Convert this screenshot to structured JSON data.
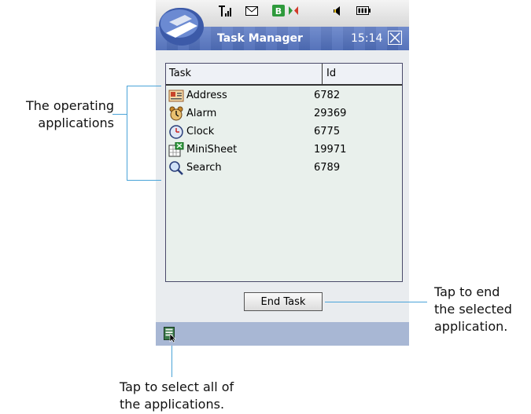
{
  "status_bar": {
    "icons": [
      "signal-icon",
      "message-icon",
      "bluetooth-icon",
      "sync-icon",
      "speaker-icon",
      "battery-icon"
    ]
  },
  "title_bar": {
    "title": "Task Manager",
    "time": "15:14"
  },
  "task_table": {
    "columns": [
      "Task",
      "Id"
    ],
    "rows": [
      {
        "task": "Address",
        "id": "6782",
        "icon": "address-book-icon"
      },
      {
        "task": "Alarm",
        "id": "29369",
        "icon": "alarm-icon"
      },
      {
        "task": "Clock",
        "id": "6775",
        "icon": "clock-icon"
      },
      {
        "task": "MiniSheet",
        "id": "19971",
        "icon": "minisheet-icon"
      },
      {
        "task": "Search",
        "id": "6789",
        "icon": "search-icon"
      }
    ]
  },
  "end_task_label": "End Task",
  "callouts": {
    "operating_apps": [
      "The operating",
      "applications"
    ],
    "end_task": [
      "Tap to end",
      "the selected",
      "application."
    ],
    "select_all": [
      "Tap to select all of",
      "the applications."
    ]
  },
  "colors": {
    "title_bar": "#5a79c4",
    "bottom_bar": "#a8b7d4",
    "callout_line": "#4aa3d8"
  }
}
